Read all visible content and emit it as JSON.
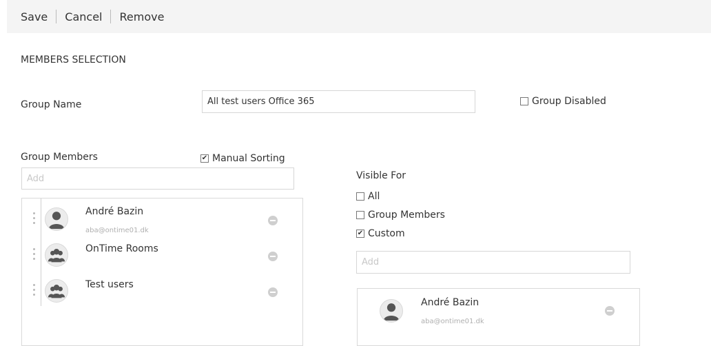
{
  "toolbar": {
    "save_label": "Save",
    "cancel_label": "Cancel",
    "remove_label": "Remove"
  },
  "section_title": "MEMBERS SELECTION",
  "group_name": {
    "label": "Group Name",
    "value": "All test users Office 365"
  },
  "group_disabled": {
    "label": "Group Disabled",
    "checked": false
  },
  "group_members": {
    "label": "Group Members",
    "manual_sorting_label": "Manual Sorting",
    "manual_sorting_checked": true,
    "add_placeholder": "Add",
    "items": [
      {
        "name": "André Bazin",
        "email": "aba@ontime01.dk",
        "type": "user"
      },
      {
        "name": "OnTime Rooms",
        "email": "",
        "type": "group"
      },
      {
        "name": "Test users",
        "email": "",
        "type": "group"
      }
    ]
  },
  "visible_for": {
    "label": "Visible For",
    "options": [
      {
        "label": "All",
        "checked": false
      },
      {
        "label": "Group Members",
        "checked": false
      },
      {
        "label": "Custom",
        "checked": true
      }
    ],
    "add_placeholder": "Add",
    "items": [
      {
        "name": "André Bazin",
        "email": "aba@ontime01.dk",
        "type": "user"
      }
    ]
  },
  "icons": {
    "checkmark": "checkmark-icon",
    "user": "user-avatar-icon",
    "group": "group-avatar-icon",
    "remove": "minus-circle-icon",
    "drag": "drag-handle-icon"
  },
  "colors": {
    "toolbar_bg": "#f4f4f4",
    "border": "#d9d9d9",
    "remove_button": "#cfcfcf",
    "email_text": "#b0b0b0"
  }
}
